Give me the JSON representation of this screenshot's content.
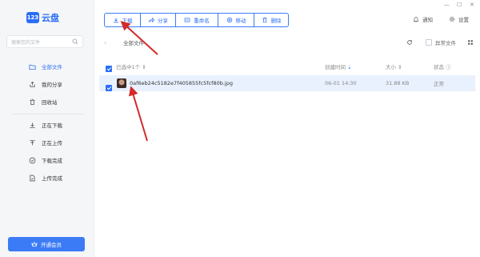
{
  "app": {
    "logo_mark": "123",
    "logo_text": "云盘"
  },
  "search": {
    "placeholder": "搜索您的文件"
  },
  "sidebar": {
    "items": [
      {
        "label": "全部文件",
        "icon": "folder-icon",
        "active": true
      },
      {
        "label": "我的分享",
        "icon": "share-icon",
        "active": false
      },
      {
        "label": "回收站",
        "icon": "trash-icon",
        "active": false
      }
    ],
    "transfer_items": [
      {
        "label": "正在下载",
        "icon": "download-icon"
      },
      {
        "label": "正在上传",
        "icon": "upload-icon"
      },
      {
        "label": "下载完成",
        "icon": "check-circle-icon"
      },
      {
        "label": "上传完成",
        "icon": "file-done-icon"
      }
    ],
    "vip_label": "开通会员"
  },
  "toolbar": {
    "download": "下载",
    "share": "分享",
    "rename": "重命名",
    "move": "移动",
    "delete": "删除"
  },
  "header": {
    "notify": "通知",
    "settings": "设置"
  },
  "breadcrumb": {
    "title": "全部文件"
  },
  "options": {
    "abnormal_files": "异常文件"
  },
  "table": {
    "selected_label": "已选中1个",
    "col_created": "创建时间",
    "col_size": "大小",
    "col_status": "状态",
    "rows": [
      {
        "name": "0af6eb24c5182e7f405855fc5fcf80b.jpg",
        "created": "06-01 14:30",
        "size": "31.88 KB",
        "status": "正常",
        "checked": true
      }
    ]
  },
  "colors": {
    "accent": "#2a6ef5",
    "arrow": "#d42a2a",
    "row_highlight": "#e9f1fe"
  }
}
